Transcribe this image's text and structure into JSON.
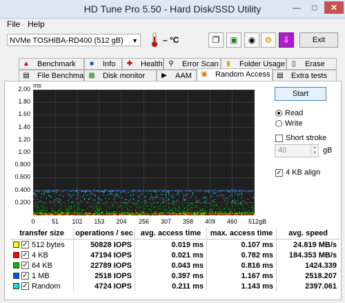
{
  "window": {
    "title": "HD Tune Pro 5.50 - Hard Disk/SSD Utility",
    "min_icon": "minimize-icon",
    "max_icon": "maximize-icon",
    "close_icon": "close-icon"
  },
  "menu": {
    "file": "File",
    "help": "Help"
  },
  "toolbar": {
    "drive": "NVMe    TOSHIBA-RD400 (512 gB)",
    "temperature": "– °C",
    "exit_label": "Exit"
  },
  "tabs_row1": [
    "Benchmark",
    "Info",
    "Health",
    "Error Scan",
    "Folder Usage",
    "Erase"
  ],
  "tabs_row2": [
    "File Benchmark",
    "Disk monitor",
    "AAM",
    "Random Access",
    "Extra tests"
  ],
  "active_tab": "Random Access",
  "controls": {
    "start_label": "Start",
    "read_label": "Read",
    "write_label": "Write",
    "read_selected": true,
    "short_stroke_label": "Short stroke",
    "short_stroke_checked": false,
    "stroke_value": "40",
    "stroke_unit": "gB",
    "align_label": "4 KB align",
    "align_checked": true
  },
  "chart_data": {
    "type": "scatter",
    "ylabel": "ms",
    "y_ticks": [
      "2.00",
      "1.80",
      "1.60",
      "1.40",
      "1.20",
      "1.00",
      "0.800",
      "0.600",
      "0.400",
      "0.200"
    ],
    "x_ticks": [
      "0",
      "51",
      "102",
      "153",
      "204",
      "256",
      "307",
      "358",
      "409",
      "460",
      "512gB"
    ],
    "xlim": [
      0,
      512
    ],
    "ylim": [
      0,
      2.0
    ],
    "background": "#1f1f1f",
    "grid": true,
    "series": [
      {
        "name": "512 bytes",
        "color": "#e8e800",
        "band": [
          0.0,
          0.05
        ],
        "x_range": [
          0,
          512
        ]
      },
      {
        "name": "4 KB",
        "color": "#cc0000",
        "band": [
          0.0,
          0.04
        ],
        "x_range": [
          0,
          512
        ]
      },
      {
        "name": "64 KB",
        "color": "#00b000",
        "band": [
          0.03,
          0.2
        ],
        "x_range": [
          0,
          512
        ]
      },
      {
        "name": "1 MB",
        "color": "#1e6fe0",
        "band": [
          0.38,
          0.41
        ],
        "x_range": [
          0,
          512
        ]
      },
      {
        "name": "Random",
        "color": "#2fd6d6",
        "band": [
          0.2,
          0.4
        ],
        "x_range": [
          0,
          512
        ]
      }
    ]
  },
  "table": {
    "headers": [
      "transfer size",
      "operations / sec",
      "avg. access time",
      "max. access time",
      "avg. speed"
    ],
    "rows": [
      {
        "color": "#ffff00",
        "size": "512 bytes",
        "ops": "50828 IOPS",
        "avg": "0.019 ms",
        "max": "0.107 ms",
        "speed": "24.819 MB/s"
      },
      {
        "color": "#ff0000",
        "size": "4 KB",
        "ops": "47194 IOPS",
        "avg": "0.021 ms",
        "max": "0.782 ms",
        "speed": "184.353 MB/s"
      },
      {
        "color": "#00c000",
        "size": "64 KB",
        "ops": "22789 IOPS",
        "avg": "0.043 ms",
        "max": "0.816 ms",
        "speed": "1424.339"
      },
      {
        "color": "#0050ff",
        "size": "1 MB",
        "ops": "2518 IOPS",
        "avg": "0.397 ms",
        "max": "1.167 ms",
        "speed": "2518.207"
      },
      {
        "color": "#00e0e0",
        "size": "Random",
        "ops": "4724 IOPS",
        "avg": "0.211 ms",
        "max": "1.143 ms",
        "speed": "2397.061"
      }
    ]
  }
}
